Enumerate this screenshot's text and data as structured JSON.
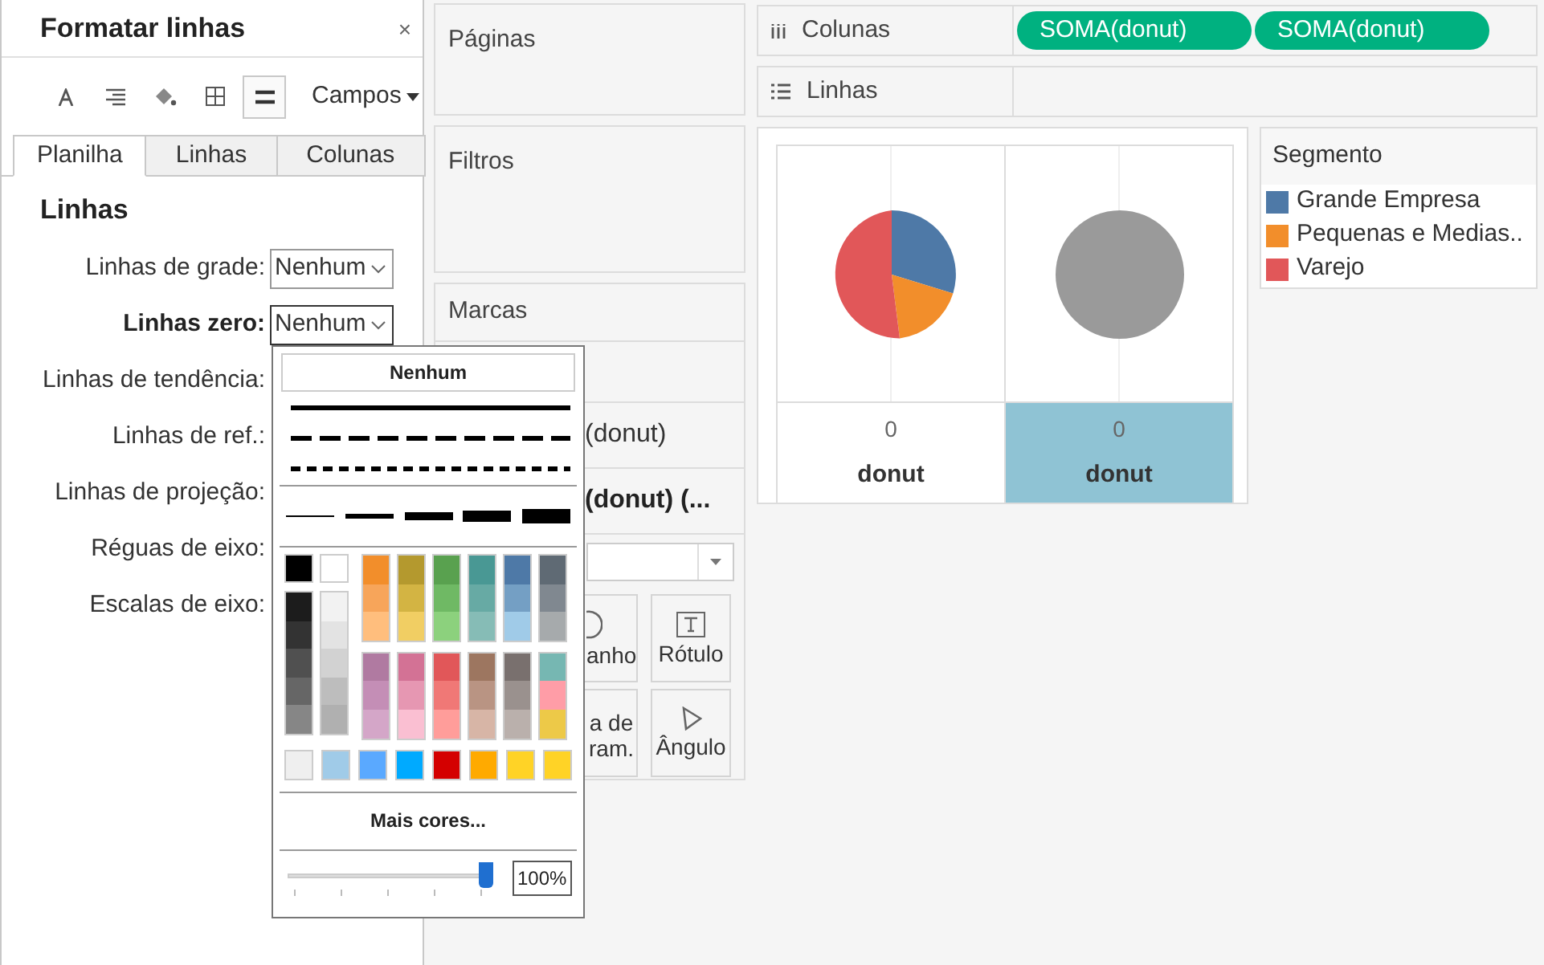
{
  "format_pane": {
    "title": "Formatar linhas",
    "close": "×",
    "fields_menu": "Campos",
    "toolbar": [
      {
        "kind": "font",
        "selected": false
      },
      {
        "kind": "align",
        "selected": false
      },
      {
        "kind": "shading",
        "selected": false
      },
      {
        "kind": "borders",
        "selected": false
      },
      {
        "kind": "lines",
        "selected": true
      }
    ],
    "tabs": [
      {
        "label": "Planilha",
        "selected": true
      },
      {
        "label": "Linhas",
        "selected": false
      },
      {
        "label": "Colunas",
        "selected": false
      }
    ],
    "section": "Linhas",
    "rows": [
      {
        "label": "Linhas de grade:",
        "value": "Nenhum",
        "selected": false
      },
      {
        "label": "Linhas zero:",
        "value": "Nenhum",
        "selected": true
      },
      {
        "label": "Linhas de tendência:",
        "selected": false
      },
      {
        "label": "Linhas de ref.:",
        "selected": false
      },
      {
        "label": "Linhas de projeção:",
        "selected": false
      },
      {
        "label": "Réguas de eixo:",
        "selected": false
      },
      {
        "label": "Escalas de eixo:",
        "selected": false
      }
    ]
  },
  "line_menu": {
    "none_button": "Nenhum",
    "gray_columns": [
      [
        {
          "color": "#000000"
        },
        {
          "color": "#1c1c1c"
        },
        {
          "color": "#333333"
        },
        {
          "color": "#505050"
        },
        {
          "color": "#666666"
        },
        {
          "color": "#868686"
        }
      ],
      [
        {
          "color": "#ffffff"
        },
        {
          "color": "#f2f2f2"
        },
        {
          "color": "#e3e3e3"
        },
        {
          "color": "#d2d2d2"
        },
        {
          "color": "#bdbdbd"
        },
        {
          "color": "#b0b0b0"
        }
      ]
    ],
    "hue_groups": [
      [
        [
          {
            "color": "#f28e2b"
          },
          {
            "color": "#f7a55a"
          },
          {
            "color": "#ffbe7d"
          }
        ],
        [
          {
            "color": "#b4992e"
          },
          {
            "color": "#d3b443"
          },
          {
            "color": "#f1ce63"
          }
        ],
        [
          {
            "color": "#59a14f"
          },
          {
            "color": "#6fb964"
          },
          {
            "color": "#8cd17d"
          }
        ],
        [
          {
            "color": "#499894"
          },
          {
            "color": "#67aaa4"
          },
          {
            "color": "#86bcb6"
          }
        ],
        [
          {
            "color": "#4e79a7"
          },
          {
            "color": "#749fc4"
          },
          {
            "color": "#a0cbe8"
          }
        ],
        [
          {
            "color": "#5f6a74"
          },
          {
            "color": "#808890"
          },
          {
            "color": "#a6aaac"
          }
        ]
      ],
      [
        [
          {
            "color": "#b07aa1"
          },
          {
            "color": "#c48eb6"
          },
          {
            "color": "#d4a6c8"
          }
        ],
        [
          {
            "color": "#d37295"
          },
          {
            "color": "#e697b2"
          },
          {
            "color": "#fabfd2"
          }
        ],
        [
          {
            "color": "#e15759"
          },
          {
            "color": "#f07876"
          },
          {
            "color": "#ff9d9a"
          }
        ],
        [
          {
            "color": "#9d7660"
          },
          {
            "color": "#b99483"
          },
          {
            "color": "#d7b5a6"
          }
        ],
        [
          {
            "color": "#79706e"
          },
          {
            "color": "#9a918e"
          },
          {
            "color": "#bab0ac"
          }
        ],
        [
          {
            "color": "#76b7b2"
          },
          {
            "color": "#ff9da7"
          },
          {
            "color": "#edc948"
          }
        ]
      ]
    ],
    "basic_colors": [
      {
        "color": "#efefef"
      },
      {
        "color": "#a0cbe8"
      },
      {
        "color": "#5aa9ff"
      },
      {
        "color": "#00aaff"
      },
      {
        "color": "#d40000"
      },
      {
        "color": "#ffaa00"
      },
      {
        "color": "#ffd326"
      },
      {
        "color": "#ffd326"
      }
    ],
    "more_colors": "Mais cores...",
    "opacity": {
      "level": 1,
      "reading": "100%"
    }
  },
  "cards": {
    "pages": "Páginas",
    "filters": "Filtros",
    "marks": {
      "title": "Marcas",
      "rows": [
        {
          "label": "(donut)",
          "bold": false
        },
        {
          "label": "(donut) (...",
          "bold": true
        }
      ],
      "buttons": [
        {
          "kind": "size",
          "label": "anho"
        },
        {
          "kind": "label",
          "label": "Rótulo"
        },
        {
          "kind": "color",
          "label": "a de ram."
        },
        {
          "kind": "angle",
          "label": "Ângulo"
        }
      ]
    }
  },
  "shelves": {
    "columns": {
      "label": "Colunas",
      "pills": [
        "SOMA(donut)",
        "SOMA(donut)"
      ]
    },
    "rows": {
      "label": "Linhas"
    }
  },
  "view": {
    "panes": [
      {
        "kind": "pie",
        "axis_tick": "0",
        "axis_title": "donut",
        "selected": false
      },
      {
        "kind": "circle",
        "axis_tick": "0",
        "axis_title": "donut",
        "selected": true
      }
    ]
  },
  "legend": {
    "title": "Segmento",
    "items": [
      {
        "label": "Grande Empresa",
        "color": "#4e79a7"
      },
      {
        "label": "Pequenas e Medias..",
        "color": "#f28e2b"
      },
      {
        "label": "Varejo",
        "color": "#e15759"
      }
    ]
  }
}
